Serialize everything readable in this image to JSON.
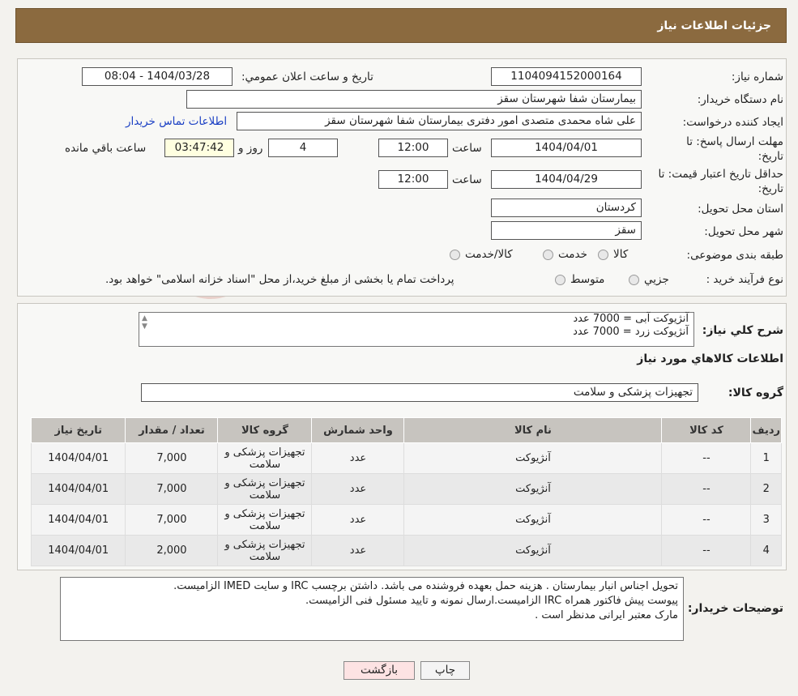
{
  "header": {
    "title": "جزئیات اطلاعات نیاز"
  },
  "form": {
    "need_number_label": "شماره نیاز:",
    "need_number": "1104094152000164",
    "announce_label": "تاریخ و ساعت اعلان عمومي:",
    "announce_value": "1404/03/28 - 08:04",
    "buyer_org_label": "نام دستگاه خريدار:",
    "buyer_org": "بیمارستان شفا شهرستان سقز",
    "creator_label": "ايجاد كننده درخواست:",
    "creator": "علی شاه محمدی متصدی امور دفتری بیمارستان شفا شهرستان سقز",
    "contact_link": "اطلاعات تماس خریدار",
    "deadline_label_1": "مهلت ارسال پاسخ: تا",
    "deadline_label_2": "تاريخ:",
    "deadline_date": "1404/04/01",
    "time_label": "ساعت",
    "deadline_time": "12:00",
    "days": "4",
    "days_label": "روز و",
    "remaining": "03:47:42",
    "remaining_label": "ساعت باقي مانده",
    "validity_label_1": "حداقل تاريخ اعتبار قيمت: تا",
    "validity_label_2": "تاريخ:",
    "validity_date": "1404/04/29",
    "validity_time": "12:00",
    "province_label": "استان محل تحويل:",
    "province": "کردستان",
    "city_label": "شهر محل تحويل:",
    "city": "سقز",
    "category_label": "طبقه بندی موضوعی:",
    "category_options": [
      "کالا",
      "خدمت",
      "کالا/خدمت"
    ],
    "process_label": "نوع فرآيند خريد :",
    "process_options": [
      "جزيي",
      "متوسط"
    ],
    "process_note": "پرداخت تمام یا بخشی از مبلغ خرید،از محل \"اسناد خزانه اسلامی\" خواهد بود."
  },
  "summary": {
    "label": "شرح كلي نياز:",
    "lines": [
      "آنژیوکت آبی = 7000 عدد",
      "آنژیوکت زرد = 7000 عدد"
    ],
    "items_title": "اطلاعات كالاهاي مورد نياز",
    "group_label": "گروه كالا:",
    "group_value": "تجهیزات پزشکی و سلامت"
  },
  "table": {
    "headers": [
      "رديف",
      "كد كالا",
      "نام كالا",
      "واحد شمارش",
      "گروه كالا",
      "تعداد / مقدار",
      "تاريخ نياز"
    ],
    "rows": [
      {
        "idx": "1",
        "code": "--",
        "name": "آنژیوکت",
        "unit": "عدد",
        "group": "تجهیزات پزشکی و سلامت",
        "qty": "7,000",
        "date": "1404/04/01"
      },
      {
        "idx": "2",
        "code": "--",
        "name": "آنژیوکت",
        "unit": "عدد",
        "group": "تجهیزات پزشکی و سلامت",
        "qty": "7,000",
        "date": "1404/04/01"
      },
      {
        "idx": "3",
        "code": "--",
        "name": "آنژیوکت",
        "unit": "عدد",
        "group": "تجهیزات پزشکی و سلامت",
        "qty": "7,000",
        "date": "1404/04/01"
      },
      {
        "idx": "4",
        "code": "--",
        "name": "آنژیوکت",
        "unit": "عدد",
        "group": "تجهیزات پزشکی و سلامت",
        "qty": "2,000",
        "date": "1404/04/01"
      }
    ]
  },
  "notes": {
    "label": "توضیحات خریدار:",
    "lines": [
      "تحویل اجناس  انبار بیمارستان . هزینه حمل بعهده فروشنده می باشد.  داشتن برچسب  IRC  و سایت  IMED  الزامیست.",
      "پیوست پیش فاکتور همراه  IRC  الزامیست.ارسال نمونه و تایید مسئول فنی الزامیست.",
      "مارک معتبر ایرانی مدنظر است ."
    ]
  },
  "buttons": {
    "print": "چاپ",
    "back": "بازگشت"
  },
  "colors": {
    "header_bg": "#8b6a3f",
    "link": "#1a3fc4",
    "remaining_bg": "#ffffe0",
    "back_bg": "#fde3e3"
  }
}
